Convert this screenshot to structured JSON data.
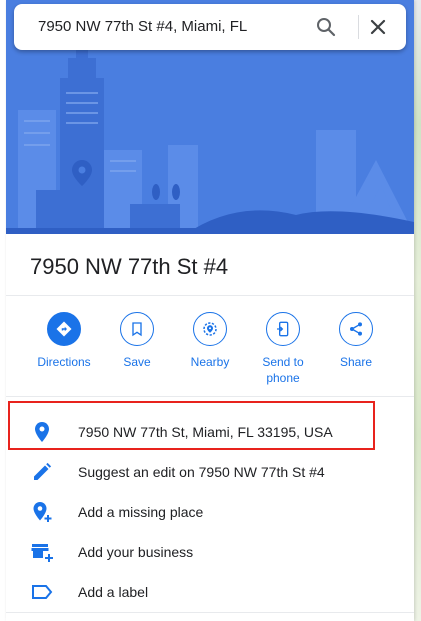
{
  "search": {
    "query": "7950 NW 77th St #4, Miami, FL",
    "search_icon": "search-icon",
    "close_icon": "close-icon"
  },
  "place": {
    "title": "7950 NW 77th St #4"
  },
  "actions": [
    {
      "label": "Directions",
      "icon": "directions-icon"
    },
    {
      "label": "Save",
      "icon": "bookmark-icon"
    },
    {
      "label": "Nearby",
      "icon": "nearby-icon"
    },
    {
      "label": "Send to phone",
      "icon": "send-to-phone-icon"
    },
    {
      "label": "Share",
      "icon": "share-icon"
    }
  ],
  "details": [
    {
      "text": "7950 NW 77th St, Miami, FL 33195, USA",
      "icon": "location-pin-icon"
    },
    {
      "text": "Suggest an edit on 7950 NW 77th St #4",
      "icon": "pencil-icon"
    },
    {
      "text": "Add a missing place",
      "icon": "add-place-icon"
    },
    {
      "text": "Add your business",
      "icon": "add-business-icon"
    },
    {
      "text": "Add a label",
      "icon": "label-icon"
    }
  ],
  "colors": {
    "accent": "#1a73e8",
    "hero": "#4a7ee0",
    "highlight": "#e8231d"
  }
}
